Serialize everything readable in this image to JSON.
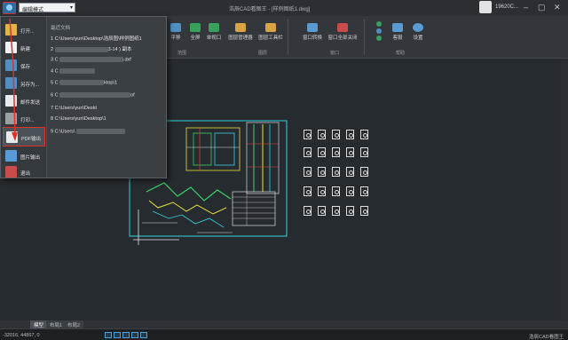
{
  "title": {
    "app": "浩辰CAD看图王 - [样例图纸1.dwg]",
    "mode": "编辑模式",
    "user": "19620C..."
  },
  "ribbon": {
    "buttons": [
      "平移",
      "全屏",
      "单视口",
      "图层管理器",
      "图层工具栏",
      "窗口转换",
      "窗口全部关闭",
      "客服",
      "设置"
    ],
    "sections": [
      "范围",
      "图层",
      "窗口",
      "帮助"
    ]
  },
  "file_menu": {
    "items": [
      "打开...",
      "新建",
      "保存",
      "另存为...",
      "邮件发送",
      "打印...",
      "PDF输出",
      "图片输出",
      "退出"
    ],
    "recent_header": "最近文档",
    "recent": [
      {
        "prefix": "1 C:\\Users\\yun\\Desktop\\浩辰图\\样例图纸1",
        "suffix": ""
      },
      {
        "prefix": "2",
        "suffix": "3-14 ) 副本"
      },
      {
        "prefix": "3 C",
        "suffix": ").dxf"
      },
      {
        "prefix": "4 C",
        "suffix": ""
      },
      {
        "prefix": "5 C",
        "suffix": "ktop\\1"
      },
      {
        "prefix": "6 C",
        "suffix": "of"
      },
      {
        "prefix": "7 C:\\Users\\yun\\Deskt",
        "suffix": ""
      },
      {
        "prefix": "8 C:\\Users\\yun\\Deskt",
        "suffix": "op\\1"
      },
      {
        "prefix": "9 C:\\Users\\",
        "suffix": ""
      }
    ]
  },
  "tabs": [
    "模型",
    "布局1",
    "布局2"
  ],
  "status": {
    "coords": "-32016, 44867, 0",
    "brand": "浩辰CAD看图王"
  },
  "colors": {
    "accent": "#4aa3df",
    "highlight": "#e0302a",
    "cad_green": "#3ad36a",
    "cad_yellow": "#e8e23a",
    "cad_cyan": "#35d3e0"
  }
}
